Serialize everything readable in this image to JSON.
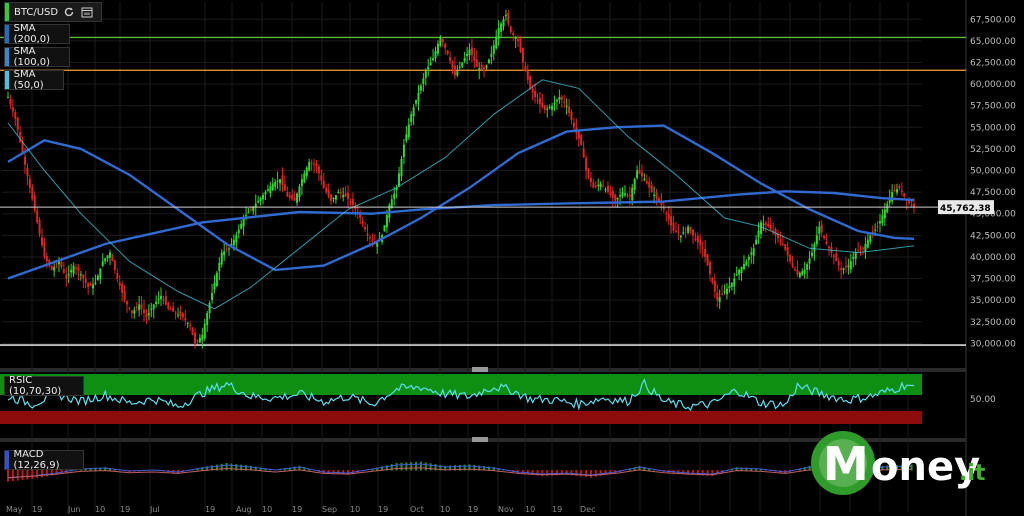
{
  "toolbar": {
    "ticker": "BTC/USD",
    "indicators": [
      {
        "label": "SMA (200,0)",
        "color": "#1f6fbf"
      },
      {
        "label": "SMA (100,0)",
        "color": "#2e8bd6"
      },
      {
        "label": "SMA (50,0)",
        "color": "#3fc9e0"
      }
    ]
  },
  "chart_data": {
    "type": "candlestick",
    "x_tick_labels": [
      "May",
      "19",
      "Jun",
      "10",
      "19",
      "Jul",
      "19",
      "Aug",
      "10",
      "19",
      "Sep",
      "10",
      "19",
      "Oct",
      "10",
      "19",
      "Nov",
      "10",
      "19",
      "Dec"
    ],
    "y_tick_labels": [
      "67,500.00",
      "65,000.00",
      "62,500.00",
      "60,000.00",
      "57,500.00",
      "55,000.00",
      "52,500.00",
      "50,000.00",
      "47,500.00",
      "45,000.00",
      "42,500.00",
      "40,000.00",
      "37,500.00",
      "35,000.00",
      "32,500.00",
      "30,000.00"
    ],
    "ylim": [
      29000,
      69500
    ],
    "last_price": 45762.38,
    "last_price_label": "45,762.38",
    "horizontal_lines": [
      {
        "value": 65400,
        "color": "#5dbb3c"
      },
      {
        "value": 61600,
        "color": "#f0a030"
      },
      {
        "value": 29800,
        "color": "#ffffff"
      }
    ],
    "price_path": [
      [
        0,
        58500
      ],
      [
        3,
        56000
      ],
      [
        6,
        52000
      ],
      [
        9,
        48000
      ],
      [
        12,
        44000
      ],
      [
        15,
        40000
      ],
      [
        18,
        38500
      ],
      [
        21,
        39500
      ],
      [
        24,
        37500
      ],
      [
        27,
        39000
      ],
      [
        30,
        38000
      ],
      [
        33,
        36500
      ],
      [
        36,
        37000
      ],
      [
        39,
        39500
      ],
      [
        42,
        40500
      ],
      [
        45,
        37500
      ],
      [
        48,
        35000
      ],
      [
        51,
        33500
      ],
      [
        54,
        34500
      ],
      [
        57,
        33000
      ],
      [
        60,
        34500
      ],
      [
        63,
        35500
      ],
      [
        66,
        34000
      ],
      [
        69,
        33500
      ],
      [
        72,
        33000
      ],
      [
        75,
        32000
      ],
      [
        77,
        30000
      ],
      [
        80,
        31000
      ],
      [
        82,
        33500
      ],
      [
        85,
        37000
      ],
      [
        88,
        40500
      ],
      [
        91,
        41000
      ],
      [
        94,
        42500
      ],
      [
        97,
        44500
      ],
      [
        100,
        45500
      ],
      [
        103,
        46500
      ],
      [
        106,
        47500
      ],
      [
        109,
        48500
      ],
      [
        112,
        49000
      ],
      [
        115,
        47000
      ],
      [
        118,
        46500
      ],
      [
        121,
        49000
      ],
      [
        124,
        51000
      ],
      [
        127,
        50500
      ],
      [
        130,
        48000
      ],
      [
        133,
        46500
      ],
      [
        136,
        47500
      ],
      [
        139,
        47000
      ],
      [
        142,
        46000
      ],
      [
        145,
        44500
      ],
      [
        148,
        42500
      ],
      [
        151,
        41500
      ],
      [
        154,
        42500
      ],
      [
        157,
        46000
      ],
      [
        160,
        48000
      ],
      [
        163,
        53000
      ],
      [
        166,
        56500
      ],
      [
        169,
        59000
      ],
      [
        172,
        61500
      ],
      [
        175,
        63000
      ],
      [
        178,
        65500
      ],
      [
        181,
        63500
      ],
      [
        184,
        61000
      ],
      [
        187,
        62500
      ],
      [
        190,
        64000
      ],
      [
        193,
        62000
      ],
      [
        196,
        61500
      ],
      [
        199,
        63500
      ],
      [
        202,
        66500
      ],
      [
        205,
        68000
      ],
      [
        207,
        66000
      ],
      [
        210,
        65000
      ],
      [
        212,
        62500
      ],
      [
        215,
        59500
      ],
      [
        218,
        58000
      ],
      [
        221,
        57000
      ],
      [
        224,
        57500
      ],
      [
        227,
        58500
      ],
      [
        230,
        57500
      ],
      [
        233,
        55000
      ],
      [
        236,
        53000
      ],
      [
        238,
        50000
      ],
      [
        241,
        48000
      ],
      [
        244,
        48500
      ],
      [
        247,
        47500
      ],
      [
        250,
        46500
      ],
      [
        253,
        47500
      ],
      [
        256,
        47000
      ],
      [
        259,
        50000
      ],
      [
        262,
        49000
      ],
      [
        265,
        47500
      ],
      [
        268,
        46500
      ],
      [
        271,
        45000
      ],
      [
        274,
        43000
      ],
      [
        277,
        42500
      ],
      [
        280,
        43500
      ],
      [
        283,
        42000
      ],
      [
        286,
        41000
      ],
      [
        289,
        38000
      ],
      [
        292,
        35000
      ],
      [
        295,
        36000
      ],
      [
        298,
        37000
      ],
      [
        301,
        38500
      ],
      [
        304,
        39500
      ],
      [
        307,
        41000
      ],
      [
        310,
        44000
      ],
      [
        313,
        43500
      ],
      [
        316,
        42500
      ],
      [
        319,
        41500
      ],
      [
        322,
        39500
      ],
      [
        325,
        38000
      ],
      [
        328,
        38500
      ],
      [
        331,
        40500
      ],
      [
        334,
        43500
      ],
      [
        337,
        41500
      ],
      [
        340,
        40000
      ],
      [
        343,
        38500
      ],
      [
        346,
        39000
      ],
      [
        349,
        40500
      ],
      [
        352,
        41000
      ],
      [
        355,
        42500
      ],
      [
        358,
        43500
      ],
      [
        361,
        45500
      ],
      [
        364,
        47500
      ],
      [
        367,
        48000
      ],
      [
        370,
        46500
      ],
      [
        373,
        45762
      ]
    ],
    "series": [
      {
        "name": "SMA (200,0)",
        "color": "#2f6ad0",
        "values": [
          [
            0,
            37500
          ],
          [
            40,
            41500
          ],
          [
            80,
            44000
          ],
          [
            120,
            45200
          ],
          [
            150,
            45000
          ],
          [
            170,
            45500
          ],
          [
            200,
            46000
          ],
          [
            230,
            46200
          ],
          [
            270,
            46400
          ],
          [
            300,
            47200
          ],
          [
            320,
            47600
          ],
          [
            340,
            47400
          ],
          [
            360,
            46800
          ],
          [
            373,
            46600
          ]
        ]
      },
      {
        "name": "SMA (100,0)",
        "color": "#2f6ad0",
        "values": [
          [
            0,
            51000
          ],
          [
            15,
            53500
          ],
          [
            30,
            52500
          ],
          [
            50,
            49500
          ],
          [
            70,
            45500
          ],
          [
            90,
            41500
          ],
          [
            110,
            38500
          ],
          [
            130,
            39000
          ],
          [
            150,
            41500
          ],
          [
            170,
            44500
          ],
          [
            190,
            48000
          ],
          [
            210,
            52000
          ],
          [
            230,
            54500
          ],
          [
            250,
            55000
          ],
          [
            270,
            55200
          ],
          [
            290,
            52000
          ],
          [
            310,
            48500
          ],
          [
            330,
            45500
          ],
          [
            350,
            43000
          ],
          [
            365,
            42200
          ],
          [
            373,
            42100
          ]
        ]
      },
      {
        "name": "SMA (50,0)",
        "color": "#3fc9e0",
        "values": [
          [
            0,
            55500
          ],
          [
            15,
            50000
          ],
          [
            30,
            45000
          ],
          [
            50,
            39500
          ],
          [
            70,
            36000
          ],
          [
            85,
            34000
          ],
          [
            100,
            36500
          ],
          [
            120,
            41000
          ],
          [
            140,
            45500
          ],
          [
            160,
            48000
          ],
          [
            180,
            51500
          ],
          [
            200,
            56500
          ],
          [
            220,
            60500
          ],
          [
            235,
            59500
          ],
          [
            255,
            54000
          ],
          [
            275,
            49500
          ],
          [
            295,
            44500
          ],
          [
            310,
            43500
          ],
          [
            330,
            41000
          ],
          [
            350,
            40500
          ],
          [
            365,
            41000
          ],
          [
            373,
            41300
          ]
        ]
      }
    ],
    "rsi": {
      "label": "RSIC (10,70,30)",
      "tick_label": "50.00",
      "overbought": 70,
      "oversold": 30,
      "values": [
        [
          0,
          55
        ],
        [
          10,
          40
        ],
        [
          20,
          60
        ],
        [
          30,
          45
        ],
        [
          40,
          58
        ],
        [
          50,
          42
        ],
        [
          60,
          50
        ],
        [
          70,
          35
        ],
        [
          80,
          62
        ],
        [
          90,
          80
        ],
        [
          100,
          55
        ],
        [
          110,
          52
        ],
        [
          120,
          60
        ],
        [
          130,
          45
        ],
        [
          140,
          55
        ],
        [
          150,
          40
        ],
        [
          160,
          70
        ],
        [
          170,
          74
        ],
        [
          180,
          60
        ],
        [
          190,
          55
        ],
        [
          200,
          75
        ],
        [
          207,
          68
        ],
        [
          215,
          50
        ],
        [
          225,
          48
        ],
        [
          235,
          40
        ],
        [
          245,
          52
        ],
        [
          255,
          45
        ],
        [
          262,
          80
        ],
        [
          270,
          45
        ],
        [
          280,
          35
        ],
        [
          290,
          40
        ],
        [
          300,
          68
        ],
        [
          310,
          42
        ],
        [
          320,
          38
        ],
        [
          325,
          76
        ],
        [
          335,
          60
        ],
        [
          345,
          48
        ],
        [
          355,
          55
        ],
        [
          365,
          70
        ],
        [
          370,
          80
        ],
        [
          373,
          70
        ]
      ]
    },
    "macd": {
      "label": "MACD (12,26,9)",
      "histogram": [
        [
          0,
          -0.8
        ],
        [
          10,
          -0.6
        ],
        [
          20,
          -0.3
        ],
        [
          30,
          0.1
        ],
        [
          40,
          0.2
        ],
        [
          50,
          -0.1
        ],
        [
          60,
          0.0
        ],
        [
          70,
          -0.2
        ],
        [
          80,
          0.2
        ],
        [
          90,
          0.5
        ],
        [
          100,
          0.3
        ],
        [
          110,
          0.0
        ],
        [
          120,
          0.3
        ],
        [
          130,
          -0.2
        ],
        [
          140,
          -0.3
        ],
        [
          150,
          0.1
        ],
        [
          160,
          0.5
        ],
        [
          170,
          0.6
        ],
        [
          180,
          0.3
        ],
        [
          190,
          0.4
        ],
        [
          200,
          0.2
        ],
        [
          210,
          -0.2
        ],
        [
          220,
          -0.4
        ],
        [
          230,
          -0.3
        ],
        [
          240,
          -0.5
        ],
        [
          250,
          -0.2
        ],
        [
          260,
          0.3
        ],
        [
          270,
          -0.1
        ],
        [
          280,
          -0.3
        ],
        [
          290,
          -0.4
        ],
        [
          300,
          0.2
        ],
        [
          310,
          0.1
        ],
        [
          320,
          -0.2
        ],
        [
          330,
          0.3
        ],
        [
          340,
          0.1
        ],
        [
          350,
          -0.1
        ],
        [
          360,
          0.3
        ],
        [
          373,
          0.4
        ]
      ]
    }
  },
  "branding": {
    "logo_text_left": "M",
    "logo_text_right": "oney",
    "logo_suffix": ".it"
  }
}
